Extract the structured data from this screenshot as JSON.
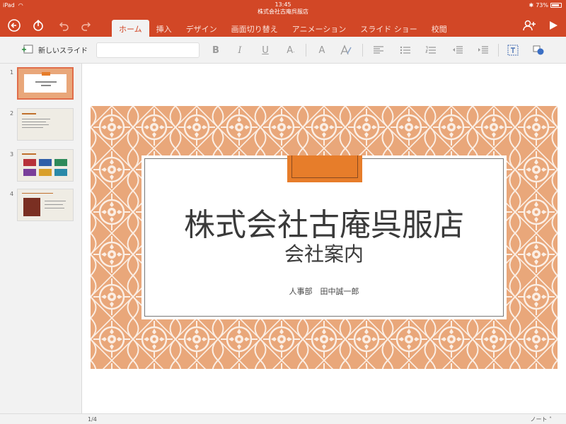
{
  "status": {
    "device": "iPad",
    "time": "13:45",
    "doc_name": "株式会社古庵呉服店",
    "battery": "73%"
  },
  "tabs": [
    "ホーム",
    "挿入",
    "デザイン",
    "画面切り替え",
    "アニメーション",
    "スライド ショー",
    "校閲"
  ],
  "toolbar": {
    "new_slide_label": "新しいスライド",
    "font_value": ""
  },
  "thumbnails": [
    "1",
    "2",
    "3",
    "4"
  ],
  "slide": {
    "title": "株式会社古庵呉服店",
    "subtitle": "会社案内",
    "author": "人事部　田中誠一郎"
  },
  "bottom": {
    "page": "1/4",
    "notes_label": "ノート"
  },
  "colors": {
    "accent": "#d24726",
    "slide_bg": "#e9a77a",
    "ribbon": "#e77d2a"
  }
}
